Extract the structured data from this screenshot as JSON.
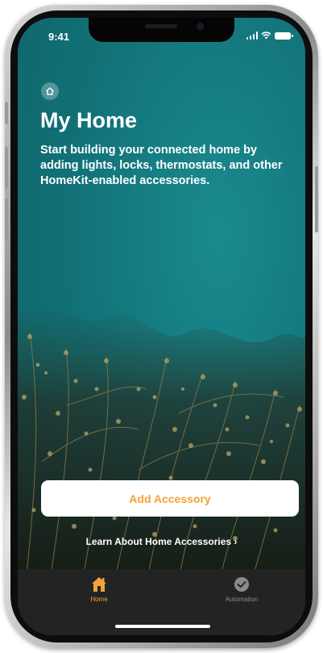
{
  "status_bar": {
    "time": "9:41"
  },
  "header": {
    "home_icon": "house-icon",
    "title": "My Home",
    "subtitle": "Start building your connected home by adding lights, locks, thermostats, and other HomeKit-enabled accessories."
  },
  "actions": {
    "add_accessory_label": "Add Accessory",
    "learn_link": "Learn About Home Accessories ›"
  },
  "tabbar": {
    "tabs": [
      {
        "label": "Home",
        "icon": "house-icon",
        "selected": true
      },
      {
        "label": "Automation",
        "icon": "clock-check-icon",
        "selected": false
      }
    ]
  },
  "colors": {
    "accent": "#f2a33a",
    "background": "#137a80",
    "tabbar": "#232323"
  }
}
